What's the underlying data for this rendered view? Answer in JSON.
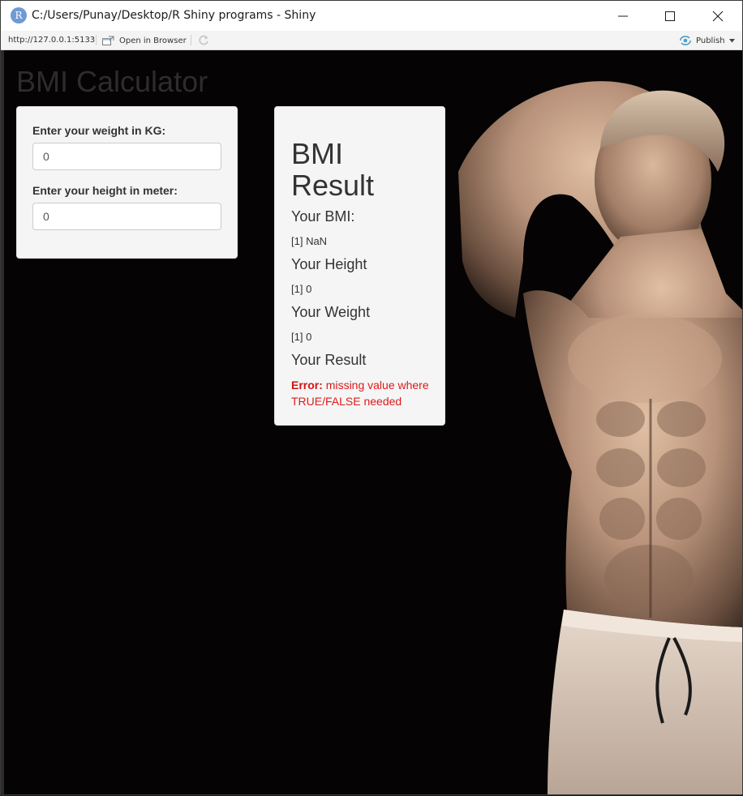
{
  "window": {
    "icon_letter": "R",
    "title": "C:/Users/Punay/Desktop/R Shiny programs - Shiny"
  },
  "toolbar": {
    "url": "http://127.0.0.1:5133",
    "open_browser_label": "Open in Browser",
    "publish_label": "Publish"
  },
  "app": {
    "title": "BMI Calculator",
    "inputs": {
      "weight_label": "Enter your weight in KG:",
      "weight_value": "0",
      "height_label": "Enter your height in meter:",
      "height_value": "0"
    },
    "results": {
      "heading": "BMI Result",
      "bmi_label": "Your BMI:",
      "bmi_value": "[1] NaN",
      "height_label": "Your Height",
      "height_value": "[1] 0",
      "weight_label": "Your Weight",
      "weight_value": "[1] 0",
      "result_label": "Your Result",
      "error_prefix": "Error:",
      "error_message": "missing value where TRUE/FALSE needed"
    }
  },
  "colors": {
    "background": "#050304",
    "well": "#f5f5f5",
    "error": "#e01a1a",
    "r_icon": "#6f9bd4",
    "publish_icon": "#4aa0c9"
  },
  "icons": {
    "app": "r-logo-icon",
    "minimize": "minimize-icon",
    "maximize": "maximize-icon",
    "close": "close-icon",
    "open_browser": "open-in-browser-icon",
    "refresh": "refresh-icon",
    "publish": "publish-icon",
    "publish_menu": "chevron-down-icon"
  }
}
